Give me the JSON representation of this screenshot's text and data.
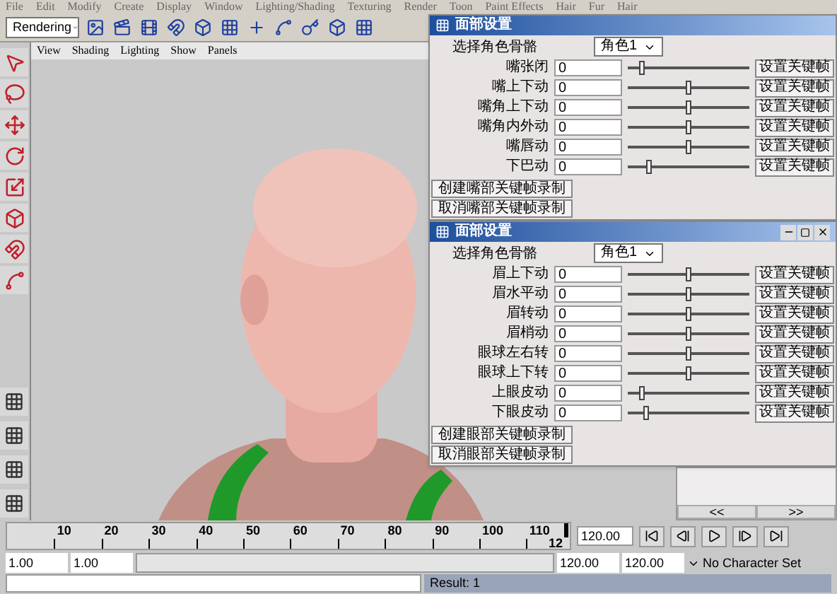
{
  "menu_bar": [
    "File",
    "Edit",
    "Modify",
    "Create",
    "Display",
    "Window",
    "Lighting/Shading",
    "Texturing",
    "Render",
    "Toon",
    "Paint Effects",
    "Hair",
    "Fur",
    "Hair"
  ],
  "toolbar": {
    "mode": "Rendering"
  },
  "viewport": {
    "menu": [
      "View",
      "Shading",
      "Lighting",
      "Show",
      "Panels"
    ],
    "kind": "picture"
  },
  "dialogs": [
    {
      "title": "面部设置",
      "controls": false,
      "select_label": "选择角色骨骼",
      "select_value": "角色1",
      "rows": [
        {
          "label": "嘴张闭",
          "value": "0",
          "level": 0.12,
          "button": "设置关键帧"
        },
        {
          "label": "嘴上下动",
          "value": "0",
          "level": 0.5,
          "button": "设置关键帧"
        },
        {
          "label": "嘴角上下动",
          "value": "0",
          "level": 0.5,
          "button": "设置关键帧"
        },
        {
          "label": "嘴角内外动",
          "value": "0",
          "level": 0.5,
          "button": "设置关键帧"
        },
        {
          "label": "嘴唇动",
          "value": "0",
          "level": 0.5,
          "button": "设置关键帧"
        },
        {
          "label": "下巴动",
          "value": "0",
          "level": 0.17,
          "button": "设置关键帧"
        }
      ],
      "buttons": [
        "创建嘴部关键帧录制",
        "取消嘴部关键帧录制"
      ]
    },
    {
      "title": "面部设置",
      "controls": true,
      "select_label": "选择角色骨骼",
      "select_value": "角色1",
      "rows": [
        {
          "label": "眉上下动",
          "value": "0",
          "level": 0.5,
          "button": "设置关键帧"
        },
        {
          "label": "眉水平动",
          "value": "0",
          "level": 0.5,
          "button": "设置关键帧"
        },
        {
          "label": "眉转动",
          "value": "0",
          "level": 0.5,
          "button": "设置关键帧"
        },
        {
          "label": "眉梢动",
          "value": "0",
          "level": 0.5,
          "button": "设置关键帧"
        },
        {
          "label": "眼球左右转",
          "value": "0",
          "level": 0.5,
          "button": "设置关键帧"
        },
        {
          "label": "眼球上下转",
          "value": "0",
          "level": 0.5,
          "button": "设置关键帧"
        },
        {
          "label": "上眼皮动",
          "value": "0",
          "level": 0.12,
          "button": "设置关键帧"
        },
        {
          "label": "下眼皮动",
          "value": "0",
          "level": 0.15,
          "button": "设置关键帧"
        }
      ],
      "buttons": [
        "创建眼部关键帧录制",
        "取消眼部关键帧录制"
      ]
    }
  ],
  "side_panel": {
    "buttons": [
      "<<",
      ">>"
    ]
  },
  "timeline": {
    "ticks": [
      "10",
      "20",
      "30",
      "40",
      "50",
      "60",
      "70",
      "80",
      "90",
      "100",
      "110"
    ],
    "end_label": "12",
    "current_frame": "120.00",
    "level": 1
  },
  "range": {
    "start": "1.00",
    "playback_start": "1.00",
    "playback_end": "120.00",
    "end": "120.00",
    "character_set": "No Character Set",
    "level": 1
  },
  "command_line": {
    "result": "Result: 1"
  }
}
